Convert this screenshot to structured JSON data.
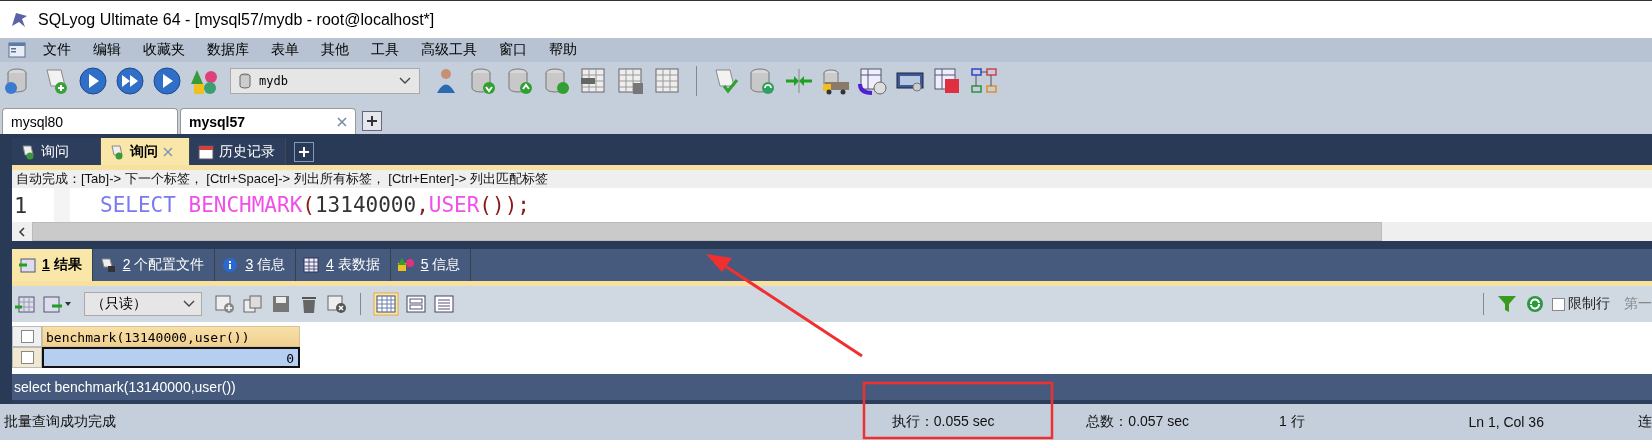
{
  "window": {
    "title": "SQLyog Ultimate 64 - [mysql57/mydb - root@localhost*]"
  },
  "menu": [
    "文件",
    "编辑",
    "收藏夹",
    "数据库",
    "表单",
    "其他",
    "工具",
    "高级工具",
    "窗口",
    "帮助"
  ],
  "toolbar": {
    "database_select": "mydb"
  },
  "connection_tabs": [
    {
      "label": "mysql80",
      "selected": false,
      "closable": false
    },
    {
      "label": "mysql57",
      "selected": true,
      "closable": true
    }
  ],
  "query_tabs": [
    {
      "label": "询问",
      "selected": false,
      "kind": "query",
      "closable": false
    },
    {
      "label": "询问",
      "selected": true,
      "kind": "query",
      "closable": true
    },
    {
      "label": "历史记录",
      "selected": false,
      "kind": "history",
      "closable": false
    }
  ],
  "autocomplete_hint": "自动完成：[Tab]-> 下一个标签， [Ctrl+Space]-> 列出所有标签， [Ctrl+Enter]-> 列出匹配标签",
  "editor": {
    "line_number": "1",
    "tokens": [
      {
        "text": "SELECT ",
        "kind": "keyword"
      },
      {
        "text": "BENCHMARK",
        "kind": "function"
      },
      {
        "text": "(",
        "kind": "punct"
      },
      {
        "text": "13140000",
        "kind": "number"
      },
      {
        "text": ",",
        "kind": "punct"
      },
      {
        "text": "USER",
        "kind": "function"
      },
      {
        "text": "()",
        "kind": "punct"
      },
      {
        "text": ")",
        "kind": "punct"
      },
      {
        "text": ";",
        "kind": "punct"
      }
    ]
  },
  "result_tabs": [
    {
      "number": "1",
      "label": "结果",
      "selected": true,
      "kind": "result"
    },
    {
      "number": "2",
      "label": "个配置文件",
      "selected": false,
      "kind": "profile"
    },
    {
      "number": "3",
      "label": "信息",
      "selected": false,
      "kind": "info"
    },
    {
      "number": "4",
      "label": "表数据",
      "selected": false,
      "kind": "table"
    },
    {
      "number": "5",
      "label": "信息",
      "selected": false,
      "kind": "shapes"
    }
  ],
  "result_toolbar": {
    "mode_select": "（只读）",
    "limit_rows": {
      "label": "限制行",
      "checked": false
    },
    "first_row_label": "第一"
  },
  "grid": {
    "select_all_checked": false,
    "columns": [
      "benchmark(13140000,user())"
    ],
    "rows": [
      {
        "cells": [
          "0"
        ],
        "selected": true,
        "checked": false
      }
    ]
  },
  "sql_bar": "select benchmark(13140000,user())",
  "status_bar": {
    "message": "批量查询成功完成",
    "execution": "执行：0.055 sec",
    "total": "总数：0.057 sec",
    "rows": "1 行",
    "position": "Ln 1, Col 36",
    "connection": "连"
  }
}
